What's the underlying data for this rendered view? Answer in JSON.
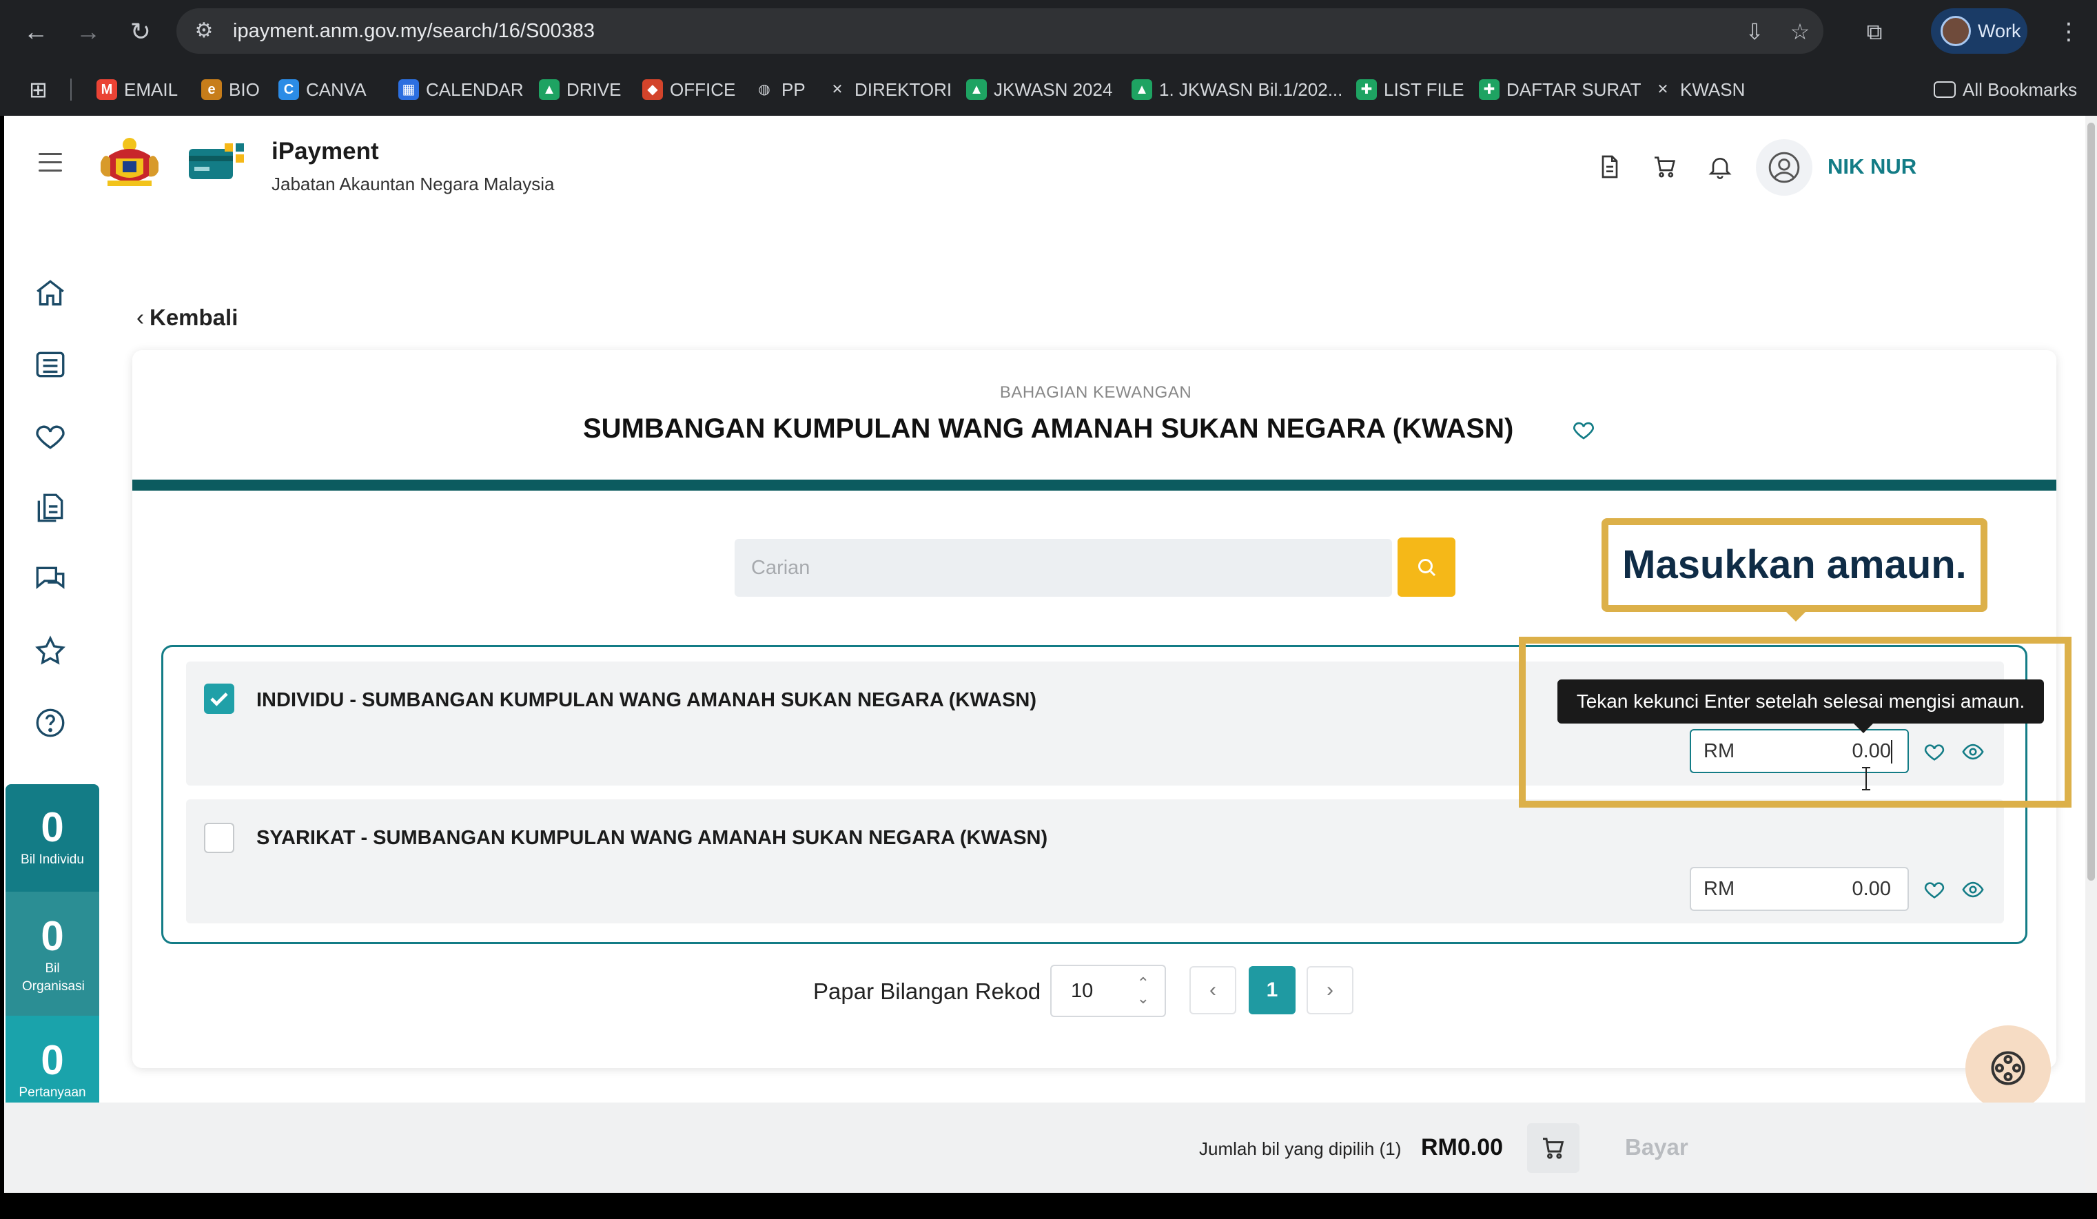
{
  "browser": {
    "url": "ipayment.anm.gov.my/search/16/S00383",
    "profile_label": "Work",
    "bookmarks": [
      {
        "label": "EMAIL",
        "icon": "gmail-icon",
        "color": "#ea4335"
      },
      {
        "label": "BIO",
        "icon": "bio-icon",
        "color": "#c77d1a"
      },
      {
        "label": "CANVA",
        "icon": "canva-icon",
        "color": "#2b8ce6"
      },
      {
        "label": "CALENDAR",
        "icon": "calendar-icon",
        "color": "#2c6fe0"
      },
      {
        "label": "DRIVE",
        "icon": "drive-icon",
        "color": "#1ea362"
      },
      {
        "label": "OFFICE",
        "icon": "office-icon",
        "color": "#d3442b"
      },
      {
        "label": "PP",
        "icon": "globe-icon",
        "color": "#5f6368"
      },
      {
        "label": "DIREKTORI",
        "icon": "joomla-icon",
        "color": "#5f6368"
      },
      {
        "label": "JKWASN 2024",
        "icon": "drive-icon",
        "color": "#1ea362"
      },
      {
        "label": "1. JKWASN Bil.1/202...",
        "icon": "drive-icon",
        "color": "#1ea362"
      },
      {
        "label": "LIST FILE",
        "icon": "sheets-icon",
        "color": "#1ea362"
      },
      {
        "label": "DAFTAR SURAT",
        "icon": "sheets-icon",
        "color": "#1ea362"
      },
      {
        "label": "KWASN",
        "icon": "joomla-icon",
        "color": "#5f6368"
      }
    ],
    "all_bookmarks": "All Bookmarks"
  },
  "header": {
    "brand_title": "iPayment",
    "brand_subtitle": "Jabatan Akauntan Negara Malaysia",
    "user_name": "NIK NUR"
  },
  "sidebar": {
    "stats": [
      {
        "value": "0",
        "caption": "Bil Individu",
        "color": "#137c86"
      },
      {
        "value": "0",
        "caption": "Bil Organisasi",
        "color": "#2b8e94"
      },
      {
        "value": "0",
        "caption": "Pertanyaan Belum Selesai",
        "color": "#1aa3ab"
      }
    ]
  },
  "main": {
    "back_label": "Kembali",
    "department": "BAHAGIAN KEWANGAN",
    "title": "SUMBANGAN KUMPULAN WANG AMANAH SUKAN NEGARA (KWASN)",
    "search_placeholder": "Carian",
    "items": [
      {
        "label": "INDIVIDU - SUMBANGAN KUMPULAN WANG AMANAH SUKAN NEGARA (KWASN)",
        "checked": true,
        "currency": "RM",
        "amount": "0.00"
      },
      {
        "label": "SYARIKAT - SUMBANGAN KUMPULAN WANG AMANAH SUKAN NEGARA (KWASN)",
        "checked": false,
        "currency": "RM",
        "amount": "0.00"
      }
    ],
    "tooltip": "Tekan kekunci Enter setelah selesai mengisi amaun.",
    "callout": "Masukkan amaun.",
    "pager": {
      "label": "Papar Bilangan Rekod",
      "per_page": "10",
      "prev": "‹",
      "current": "1",
      "next": "›"
    }
  },
  "footer": {
    "selected_label": "Jumlah bil yang dipilih (1)",
    "total": "RM0.00",
    "pay_label": "Bayar"
  },
  "colors": {
    "teal": "#137c86",
    "accent_yellow": "#f5b818",
    "callout_border": "#dcb049"
  }
}
